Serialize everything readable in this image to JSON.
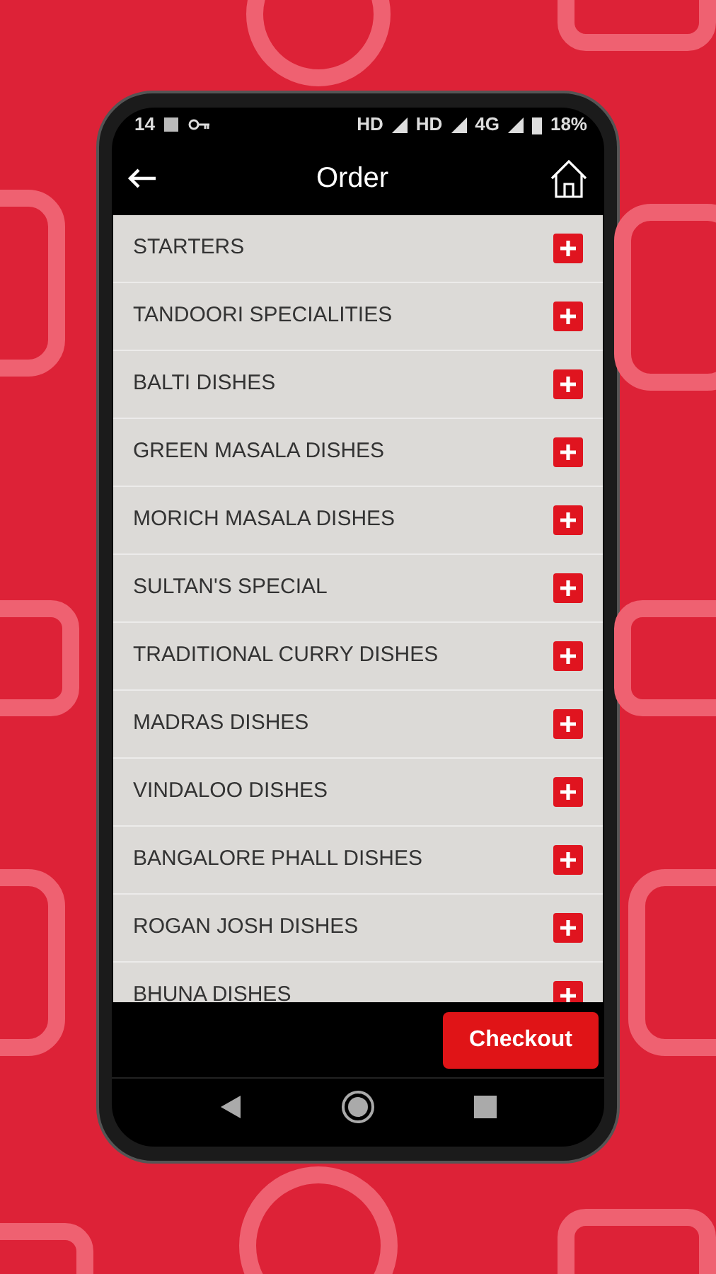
{
  "status_bar": {
    "time": "14",
    "labels": [
      "HD",
      "HD",
      "4G"
    ],
    "battery": "18%"
  },
  "header": {
    "title": "Order"
  },
  "categories": [
    {
      "label": "STARTERS"
    },
    {
      "label": "TANDOORI SPECIALITIES"
    },
    {
      "label": "BALTI DISHES"
    },
    {
      "label": "GREEN MASALA DISHES"
    },
    {
      "label": "MORICH MASALA DISHES"
    },
    {
      "label": "SULTAN'S SPECIAL"
    },
    {
      "label": "TRADITIONAL CURRY DISHES"
    },
    {
      "label": "MADRAS DISHES"
    },
    {
      "label": "VINDALOO DISHES"
    },
    {
      "label": "BANGALORE PHALL DISHES"
    },
    {
      "label": "ROGAN JOSH DISHES"
    },
    {
      "label": "BHUNA DISHES"
    }
  ],
  "checkout_button": "Checkout"
}
